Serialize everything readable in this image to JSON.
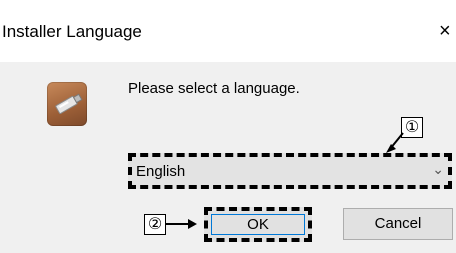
{
  "window": {
    "title": "Installer Language",
    "close_glyph": "×"
  },
  "content": {
    "icon": "installer-app-icon",
    "prompt": "Please select a language."
  },
  "language_select": {
    "selected": "English"
  },
  "buttons": {
    "ok": "OK",
    "cancel": "Cancel"
  },
  "callouts": {
    "one": "①",
    "two": "②"
  }
}
